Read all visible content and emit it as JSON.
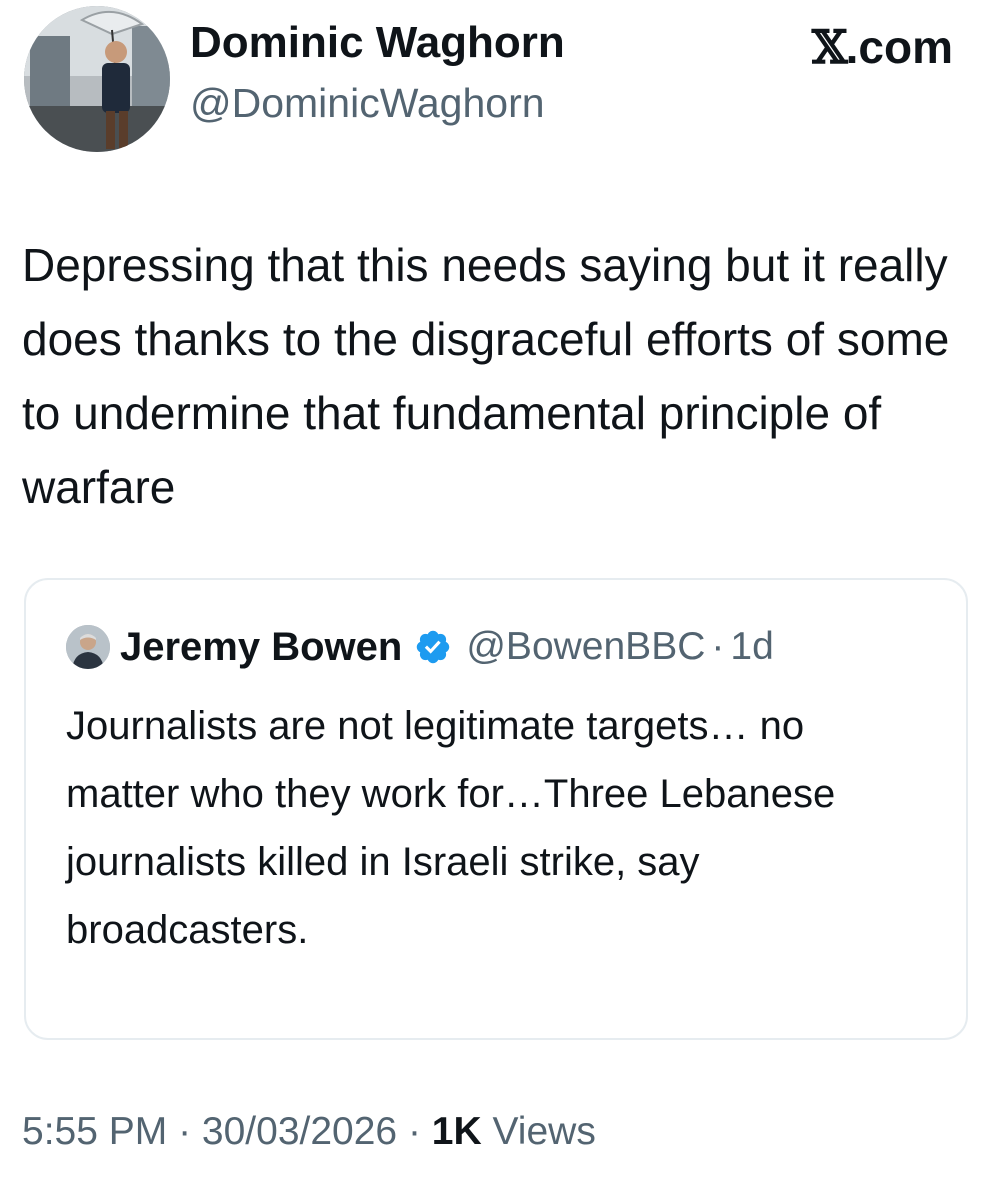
{
  "author": {
    "name": "Dominic Waghorn",
    "handle": "@DominicWaghorn",
    "avatar_icon": "profile-photo-icon"
  },
  "brand": {
    "label": "X.com",
    "glyph": "𝕏",
    "suffix": ".com"
  },
  "tweet": {
    "text": "Depressing that this needs saying but it really does thanks to the disgraceful efforts of some to undermine that fundamental principle of warfare"
  },
  "quote": {
    "name": "Jeremy Bowen",
    "verified_icon": "verified-badge-icon",
    "handle": "@BowenBBC",
    "separator": "·",
    "time": "1d",
    "text": "Journalists are not legitimate targets… no matter who they work for…Three Lebanese journalists killed in Israeli strike, say broadcasters."
  },
  "meta": {
    "time": "5:55 PM",
    "sep1": " · ",
    "date": "30/03/2026",
    "sep2": " · ",
    "views_count": "1K",
    "views_label": " Views"
  },
  "colors": {
    "text": "#0f1419",
    "secondary": "#536471",
    "verified": "#1d9bf0",
    "border": "#e6ecf0"
  }
}
